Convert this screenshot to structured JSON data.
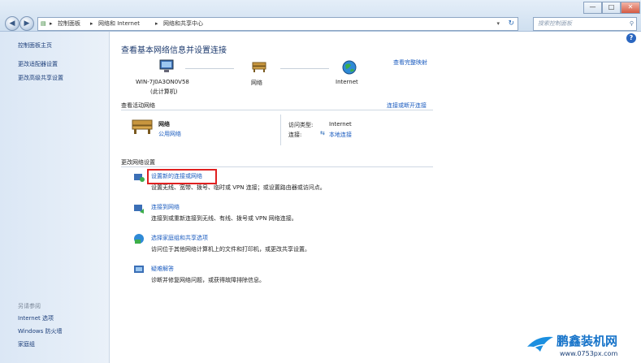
{
  "window": {
    "back_label": "◀",
    "forward_label": "▶",
    "minimize_label": "—",
    "maximize_label": "□",
    "close_label": "✕",
    "address_crumbs": [
      "控制面板",
      "网络和 Internet",
      "网络和共享中心"
    ],
    "crumb_sep": "▸",
    "refresh_label": "↻",
    "search_placeholder": "搜索控制面板",
    "help_label": "?"
  },
  "sidebar": {
    "home": "控制面板主页",
    "links": [
      "更改适配器设置",
      "更改高级共享设置"
    ],
    "see_also_header": "另请参阅",
    "see_also": [
      "Internet 选项",
      "Windows 防火墙",
      "家庭组"
    ]
  },
  "main": {
    "heading": "查看基本网络信息并设置连接",
    "view_full_map": "查看完整映射",
    "map": {
      "computer_name": "WIN-7J0A3ON0V58",
      "computer_sub": "(此计算机)",
      "network_label": "网络",
      "internet_label": "Internet"
    },
    "active_header": "查看活动网络",
    "connect_disconnect": "连接或断开连接",
    "active": {
      "name": "网络",
      "type": "公用网络",
      "access_type_label": "访问类型:",
      "access_type_value": "Internet",
      "connection_label": "连接:",
      "connection_value": "本地连接"
    },
    "change_header": "更改网络设置",
    "tasks": [
      {
        "title": "设置新的连接或网络",
        "desc": "设置无线、宽带、拨号、临时或 VPN 连接；或设置路由器或访问点。"
      },
      {
        "title": "连接到网络",
        "desc": "连接到或重新连接到无线、有线、拨号或 VPN 网络连接。"
      },
      {
        "title": "选择家庭组和共享选项",
        "desc": "访问位于其他网络计算机上的文件和打印机，或更改共享设置。"
      },
      {
        "title": "疑难解答",
        "desc": "诊断并修复网络问题，或获得故障排除信息。"
      }
    ]
  },
  "watermark": {
    "brand": "鹏鑫装机网",
    "url": "www.0753px.com",
    "brand_color": "#1673c9"
  }
}
